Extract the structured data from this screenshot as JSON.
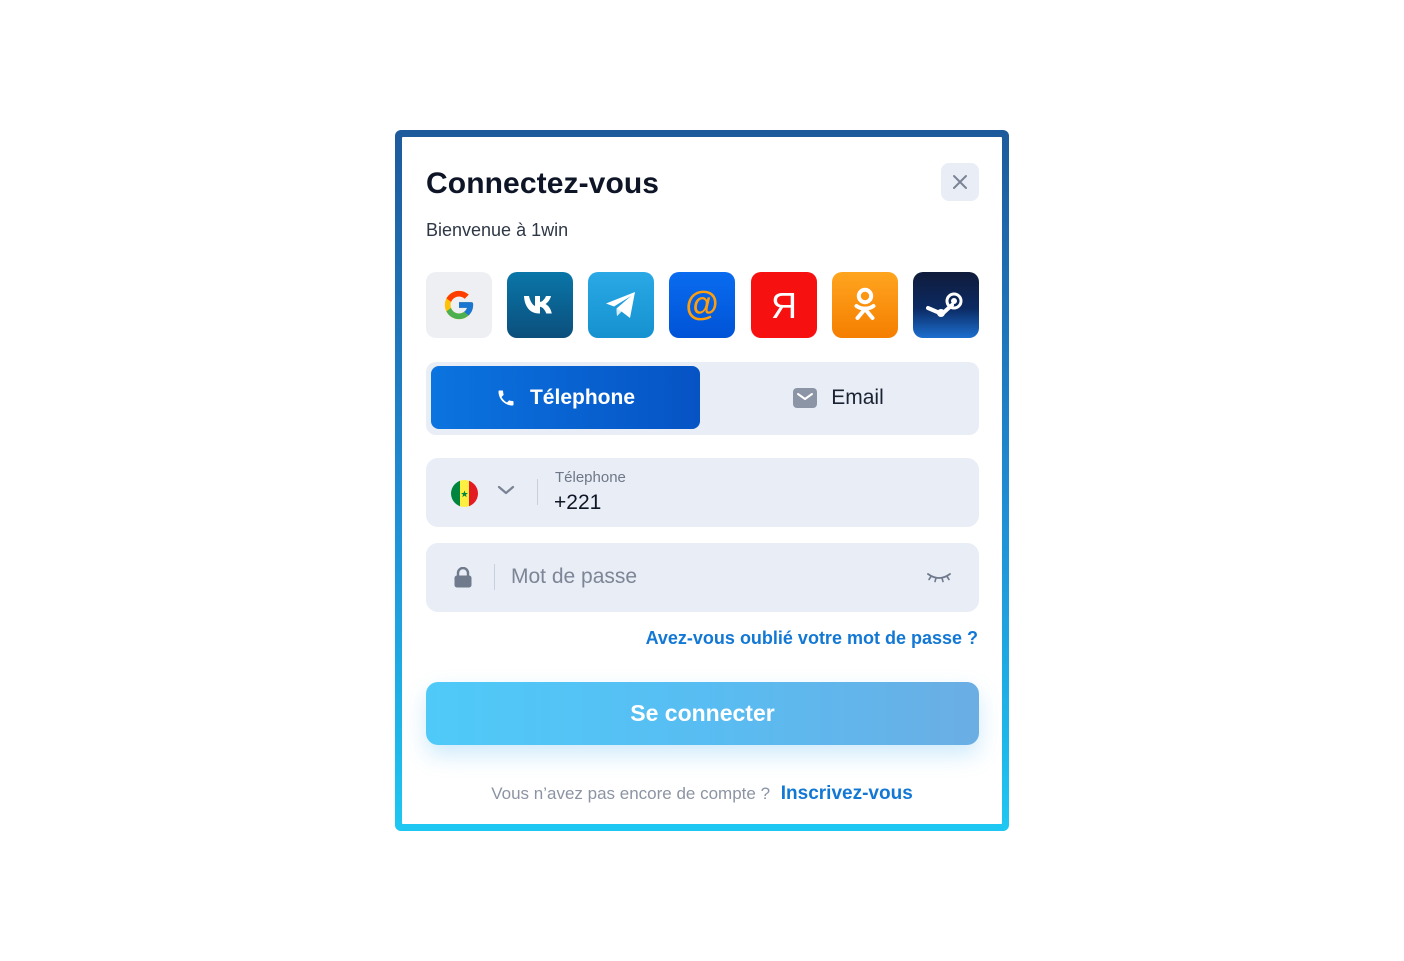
{
  "dialog": {
    "title": "Connectez-vous",
    "subtitle": "Bienvenue à 1win"
  },
  "social_logins": [
    {
      "provider": "Google",
      "icon": "google-icon",
      "label": "G"
    },
    {
      "provider": "VK",
      "icon": "vk-icon",
      "label": "vk"
    },
    {
      "provider": "Telegram",
      "icon": "telegram-icon"
    },
    {
      "provider": "Mail.ru",
      "icon": "mail-at-icon",
      "label": "@"
    },
    {
      "provider": "Yandex",
      "icon": "yandex-icon",
      "label": "Я"
    },
    {
      "provider": "Odnoklassniki",
      "icon": "ok-icon"
    },
    {
      "provider": "Steam",
      "icon": "steam-icon"
    }
  ],
  "tabs": {
    "phone_label": "Télephone",
    "email_label": "Email",
    "active": "phone"
  },
  "phone_field": {
    "label": "Télephone",
    "value": "+221",
    "country_flag": "senegal-flag-icon"
  },
  "password_field": {
    "placeholder": "Mot de passe"
  },
  "links": {
    "forgot_password": "Avez-vous oublié votre mot de passe ?",
    "no_account_question": "Vous n’avez pas encore de compte ?",
    "signup": "Inscrivez-vous"
  },
  "submit": {
    "label": "Se connecter"
  },
  "colors": {
    "primary": "#0b74df",
    "link": "#1378d4",
    "field_bg": "#e8edf6",
    "button_gradient_start": "#4fcaf8",
    "button_gradient_end": "#6aaee4"
  }
}
